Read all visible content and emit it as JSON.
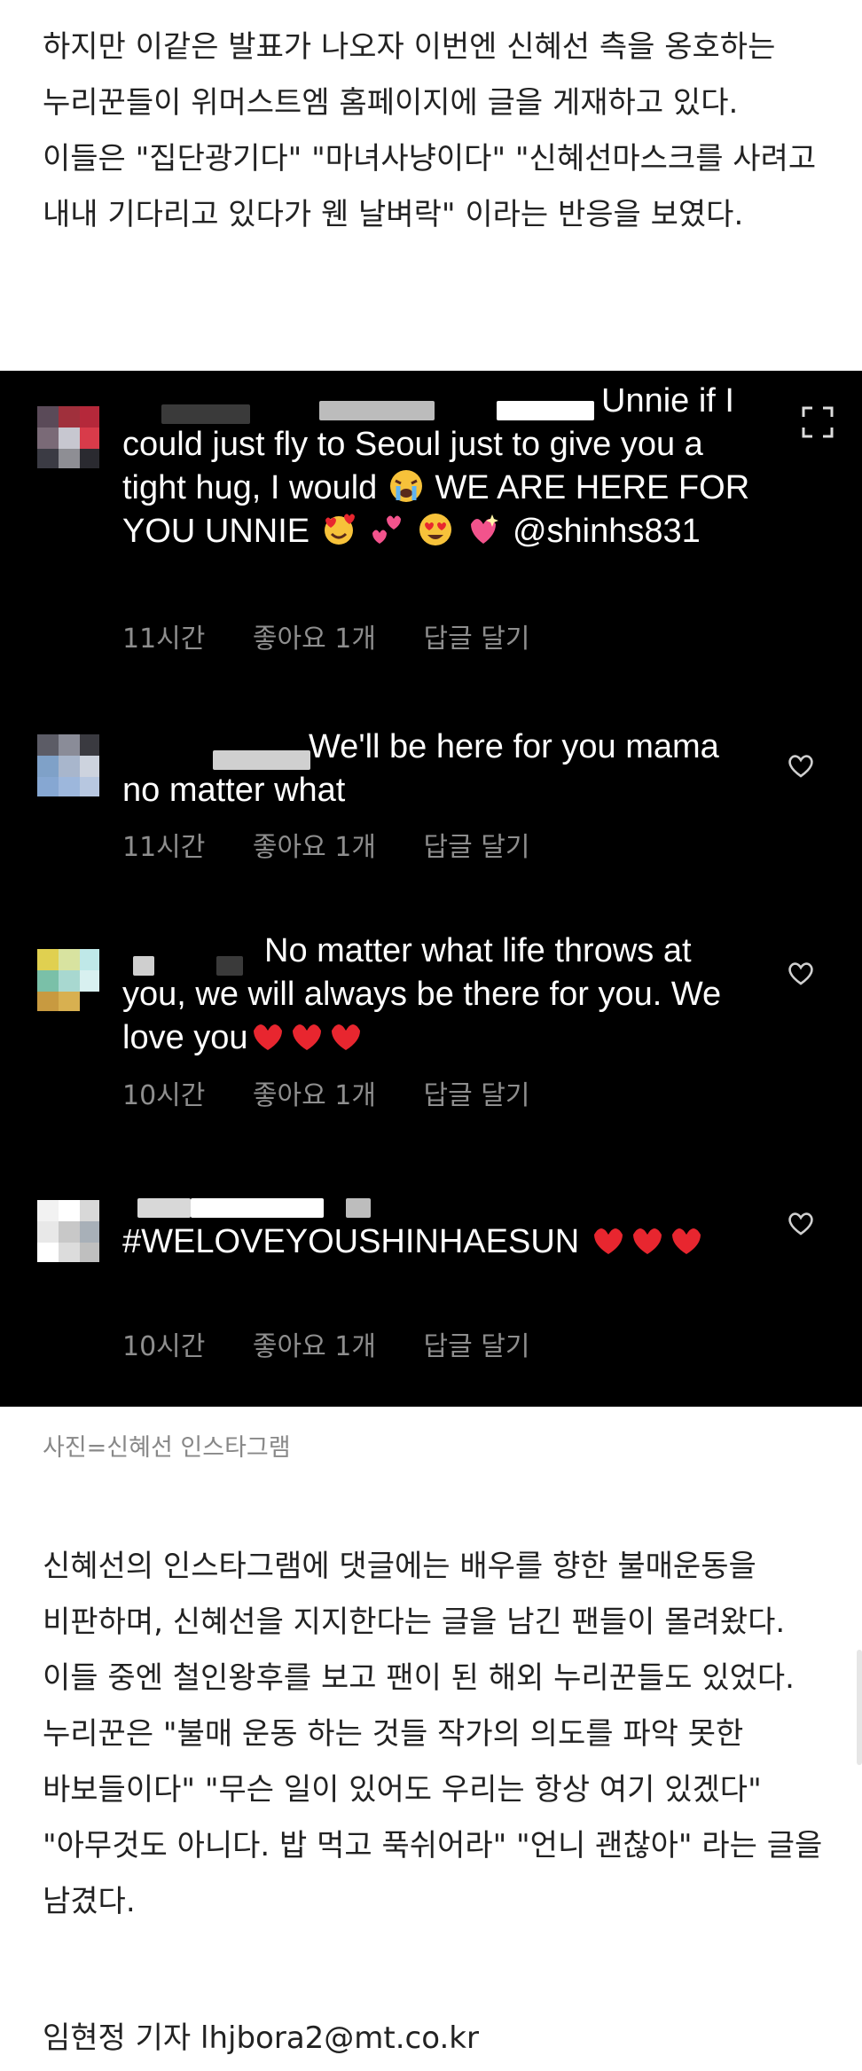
{
  "article": {
    "intro": "하지만 이같은 발표가 나오자 이번엔 신혜선 측을 옹호하는 누리꾼들이 위머스트엠 홈페이지에 글을 게재하고 있다. 이들은 \"집단광기다\" \"마녀사냥이다\" \"신혜선마스크를 사려고 내내 기다리고 있다가 웬 날벼락\" 이라는 반응을 보였다.",
    "caption": "사진=신혜선 인스타그램",
    "body": "신혜선의 인스타그램에 댓글에는 배우를 향한 불매운동을 비판하며, 신혜선을 지지한다는 글을 남긴 팬들이 몰려왔다. 이들 중엔 철인왕후를 보고 팬이 된 해외 누리꾼들도 있었다. 누리꾼은 \"불매 운동 하는 것들 작가의 의도를 파악 못한 바보들이다\" \"무슨 일이 있어도 우리는 항상 여기 있겠다\" \"아무것도 아니다. 밥 먹고 푹쉬어라\" \"언니 괜찮아\" 라는 글을 남겼다.",
    "byline": "임현정 기자 lhjbora2@mt.co.kr"
  },
  "comments": [
    {
      "text_a": "Unnie if",
      "text_b": "I could just fly to Seoul just to give you a tight hug, I would",
      "text_c": "WE ARE HERE FOR YOU UNNIE",
      "mention": "@shinhs831",
      "time": "11시간",
      "likes": "좋아요 1개",
      "reply": "답글 달기"
    },
    {
      "text_a": "We'll be here for you",
      "text_b": "mama no matter what",
      "time": "11시간",
      "likes": "좋아요 1개",
      "reply": "답글 달기"
    },
    {
      "text_a": "No matter what life throws",
      "text_b": "at you, we will always be there for you. We love you",
      "time": "10시간",
      "likes": "좋아요 1개",
      "reply": "답글 달기"
    },
    {
      "text_a": "#WELOVEYOUSHINHAESUN",
      "time": "10시간",
      "likes": "좋아요 1개",
      "reply": "답글 달기"
    }
  ],
  "colors": {
    "accent_heart": "#e8262f",
    "meta_gray": "#8e8e8e",
    "caption_gray": "#888888"
  },
  "icons": [
    "expand-icon",
    "heart-outline-icon",
    "crying-emoji",
    "smiling-hearts-emoji",
    "two-hearts-emoji",
    "heart-eyes-emoji",
    "sparkling-heart-emoji",
    "red-heart-emoji"
  ]
}
